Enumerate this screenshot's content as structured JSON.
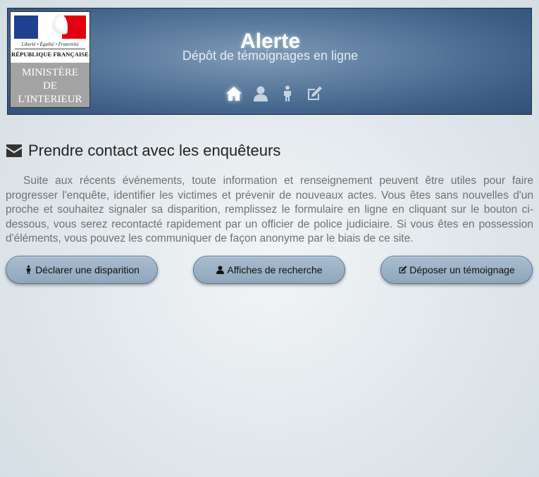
{
  "header": {
    "title": "Alerte",
    "subtitle": "Dépôt de témoignages en ligne",
    "logo": {
      "motto": "Liberté • Égalité • Fraternité",
      "republic": "RÉPUBLIQUE FRANÇAISE",
      "ministry_lines": [
        "MINISTÈRE",
        "DE",
        "L'INTERIEUR"
      ],
      "flag_colors": [
        "#1f3f8f",
        "#ffffff",
        "#e1000f"
      ]
    },
    "nav": [
      {
        "icon": "home-icon",
        "active": true
      },
      {
        "icon": "user-icon",
        "active": false
      },
      {
        "icon": "child-icon",
        "active": false
      },
      {
        "icon": "edit-icon",
        "active": false
      }
    ]
  },
  "section": {
    "icon": "envelope-icon",
    "title": "Prendre contact avec les enquêteurs",
    "intro": "Suite aux récents événements, toute information et renseignement peuvent être utiles pour faire progresser l'enquête, identifier les victimes et prévenir de nouveaux actes. Vous êtes sans nouvelles d'un proche et souhaitez signaler sa disparition, remplissez le formulaire en ligne en cliquant sur le bouton ci-dessous, vous serez recontacté rapidement par un officier de police judiciaire. Si vous êtes en possession d'éléments, vous pouvez les communiquer de façon anonyme par le biais de ce site."
  },
  "buttons": [
    {
      "label": "Déclarer une disparition",
      "icon": "child-icon"
    },
    {
      "label": "Affiches de recherche",
      "icon": "user-icon"
    },
    {
      "label": "Déposer un témoignage",
      "icon": "edit-icon"
    }
  ],
  "colors": {
    "header_bg": "#3d5f86",
    "button_bg": "#98afc4",
    "text_body": "#707070"
  }
}
